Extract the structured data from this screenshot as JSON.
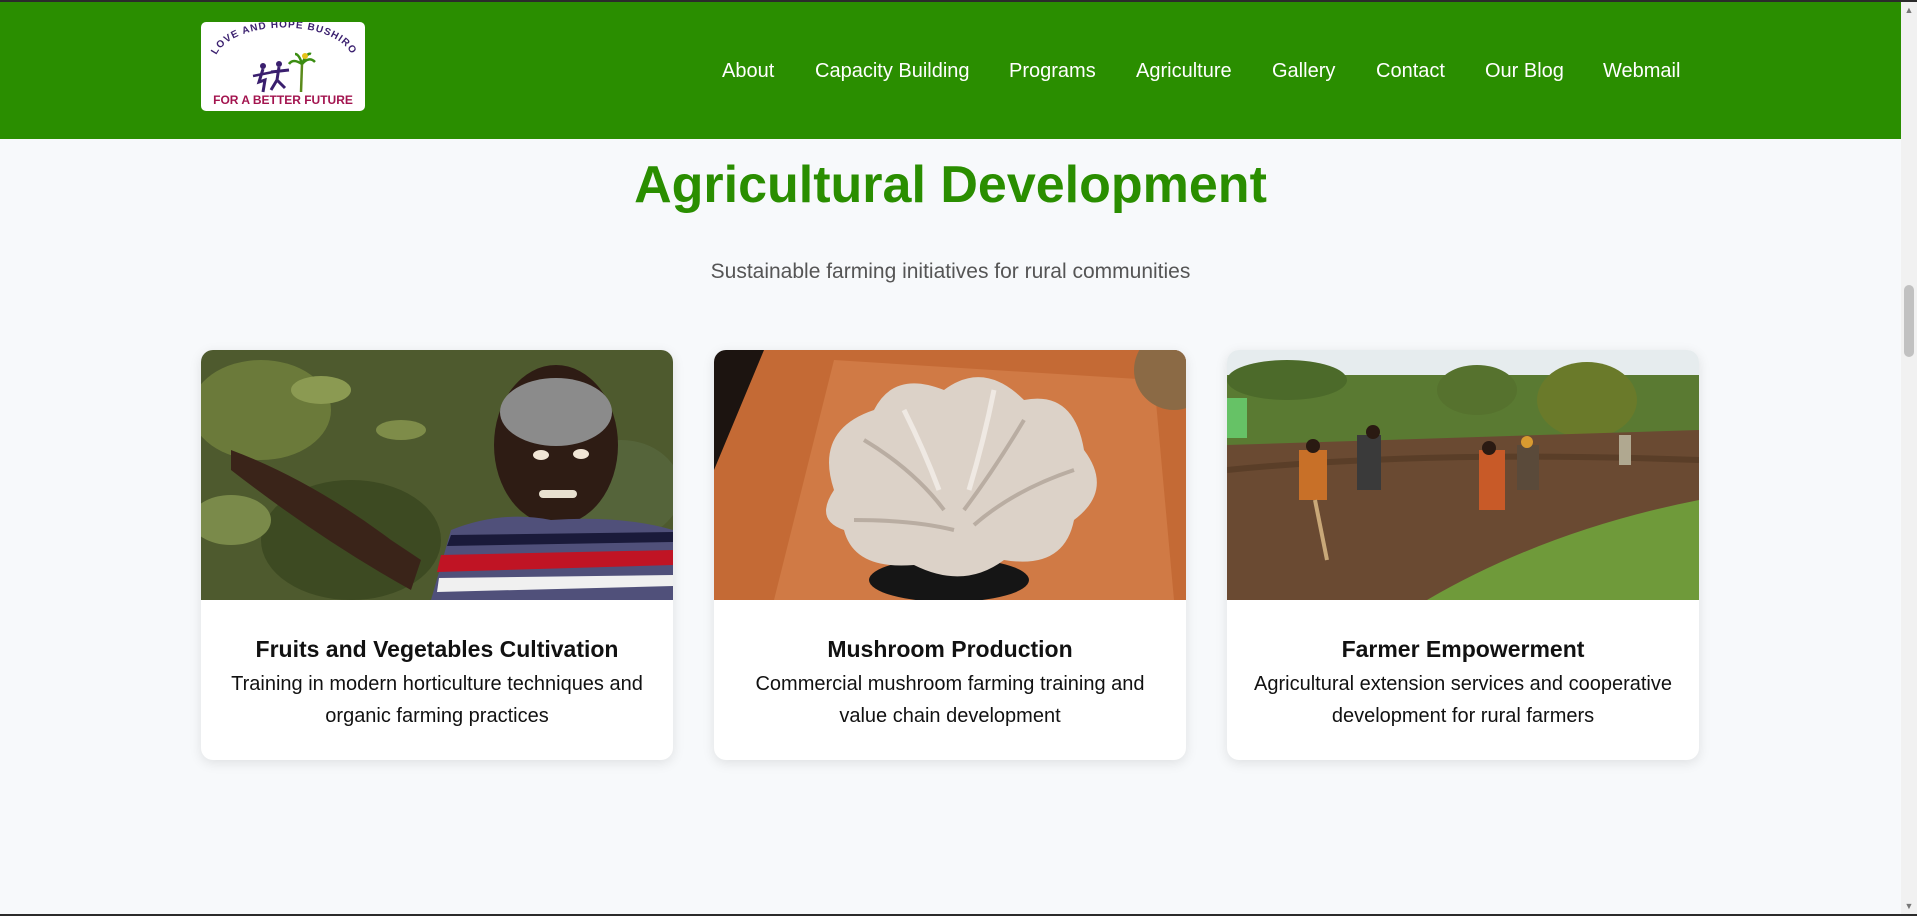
{
  "header": {
    "logo": {
      "arc_text": "LOVE AND HOPE BUSHIRO",
      "tagline": "FOR A BETTER FUTURE"
    },
    "nav": [
      {
        "label": "About"
      },
      {
        "label": "Capacity Building"
      },
      {
        "label": "Programs"
      },
      {
        "label": "Agriculture"
      },
      {
        "label": "Gallery"
      },
      {
        "label": "Contact"
      },
      {
        "label": "Our Blog"
      },
      {
        "label": "Webmail"
      }
    ]
  },
  "section": {
    "title": "Agricultural Development",
    "subtitle": "Sustainable farming initiatives for rural communities"
  },
  "cards": [
    {
      "title": "Fruits and Vegetables Cultivation",
      "description": "Training in modern horticulture techniques and organic farming practices"
    },
    {
      "title": "Mushroom Production",
      "description": "Commercial mushroom farming training and value chain development"
    },
    {
      "title": "Farmer Empowerment",
      "description": "Agricultural extension services and cooperative development for rural farmers"
    }
  ],
  "colors": {
    "brand_green": "#2a8e00",
    "page_background": "#f7f9fb",
    "logo_purple": "#3a1f6e",
    "logo_magenta": "#a3144f"
  }
}
